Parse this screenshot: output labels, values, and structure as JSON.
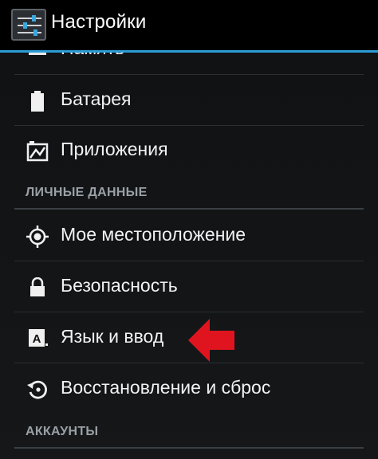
{
  "action_bar": {
    "title": "Настройки",
    "icon": "settings-sliders-icon"
  },
  "list": {
    "items": [
      {
        "label": "Память",
        "icon": "storage-icon"
      },
      {
        "label": "Батарея",
        "icon": "battery-icon"
      },
      {
        "label": "Приложения",
        "icon": "apps-icon"
      }
    ],
    "personal_section": {
      "header": "ЛИЧНЫЕ ДАННЫЕ",
      "items": [
        {
          "label": "Мое местоположение",
          "icon": "location-icon"
        },
        {
          "label": "Безопасность",
          "icon": "lock-icon"
        },
        {
          "label": "Язык и ввод",
          "icon": "language-icon"
        },
        {
          "label": "Восстановление и сброс",
          "icon": "restore-icon"
        }
      ]
    },
    "accounts_section": {
      "header": "АККАУНТЫ"
    }
  },
  "colors": {
    "accent_blue": "#2d9cd7",
    "arrow_red": "#e0141e"
  }
}
